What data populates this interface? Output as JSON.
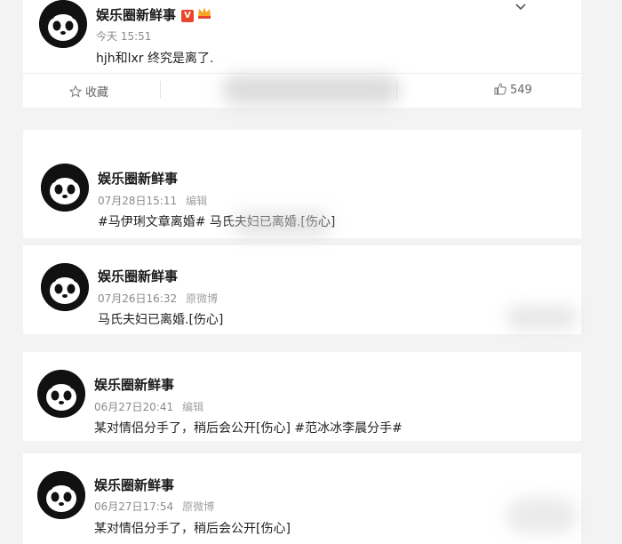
{
  "posts": [
    {
      "name": "娱乐圈新鲜事",
      "time": "今天 15:51",
      "tag": "",
      "content": "hjh和lxr 终究是离了."
    },
    {
      "name": "娱乐圈新鲜事",
      "time": "07月28日15:11",
      "tag": "编辑",
      "content": "#马伊琍文章离婚# 马氏夫妇已离婚.[伤心]"
    },
    {
      "name": "娱乐圈新鲜事",
      "time": "07月26日16:32",
      "tag": "原微博",
      "content": "马氏夫妇已离婚.[伤心]"
    },
    {
      "name": "娱乐圈新鲜事",
      "time": "06月27日20:41",
      "tag": "编辑",
      "content": "某对情侣分手了，稍后会公开[伤心] #范冰冰李晨分手#"
    },
    {
      "name": "娱乐圈新鲜事",
      "time": "06月27日17:54",
      "tag": "原微博",
      "content": "某对情侣分手了，稍后会公开[伤心]"
    }
  ],
  "first_post_badges": {
    "verified": "V",
    "crown_icon": "crown-icon"
  },
  "actions": {
    "favorite_label": "收藏",
    "like_count": "549"
  }
}
